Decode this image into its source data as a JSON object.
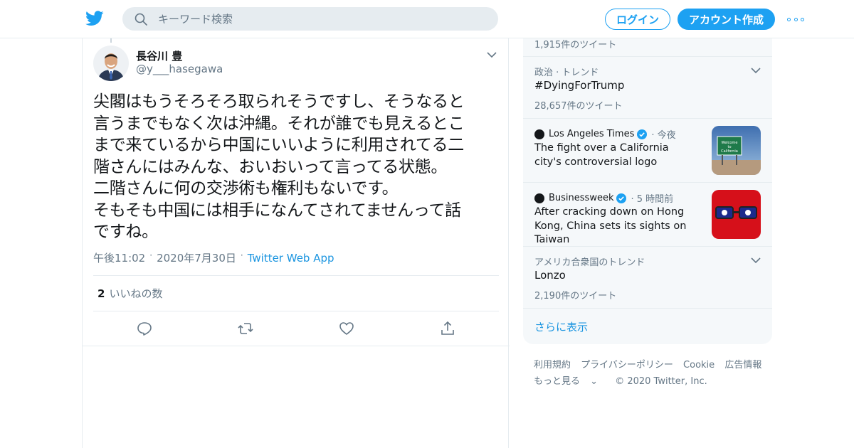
{
  "header": {
    "search_placeholder": "キーワード検索",
    "login_label": "ログイン",
    "signup_label": "アカウント作成",
    "brand_color": "#1da1f2"
  },
  "tweet": {
    "author_name": "長谷川 豊",
    "author_handle": "@y___hasegawa",
    "text": "尖閣はもうそろそろ取られそうですし、そうなると\n言うまでもなく次は沖縄。それが誰でも見えるとこ\nまで来ているから中国にいいように利用されてる二\n階さんにはみんな、おいおいって言ってる状態。\n二階さんに何の交渉術も権利もないです。\nそもそも中国には相手になんてされてませんって話\nですね。",
    "time": "午後11:02",
    "date": "2020年7月30日",
    "source": "Twitter Web App",
    "likes_count": "2",
    "likes_label": "いいねの数"
  },
  "sidebar": {
    "top_count": "1,915件のツイート",
    "trend1": {
      "meta": "政治 · トレンド",
      "name": "#DyingForTrump",
      "count": "28,657件のツイート"
    },
    "news1": {
      "source": "Los Angeles Times",
      "time": "今夜",
      "title": "The fight over a California city's controversial logo",
      "thumb_text": "Welcome to California"
    },
    "news2": {
      "source": "Businessweek",
      "time": "5 時間前",
      "title": "After cracking down on Hong Kong, China sets its sights on Taiwan"
    },
    "trend2": {
      "meta": "アメリカ合衆国のトレンド",
      "name": "Lonzo",
      "count": "2,190件のツイート"
    },
    "show_more": "さらに表示"
  },
  "footer": {
    "terms": "利用規約",
    "privacy": "プライバシーポリシー",
    "cookie": "Cookie",
    "ads": "広告情報",
    "more": "もっと見る",
    "copyright": "© 2020 Twitter, Inc."
  }
}
